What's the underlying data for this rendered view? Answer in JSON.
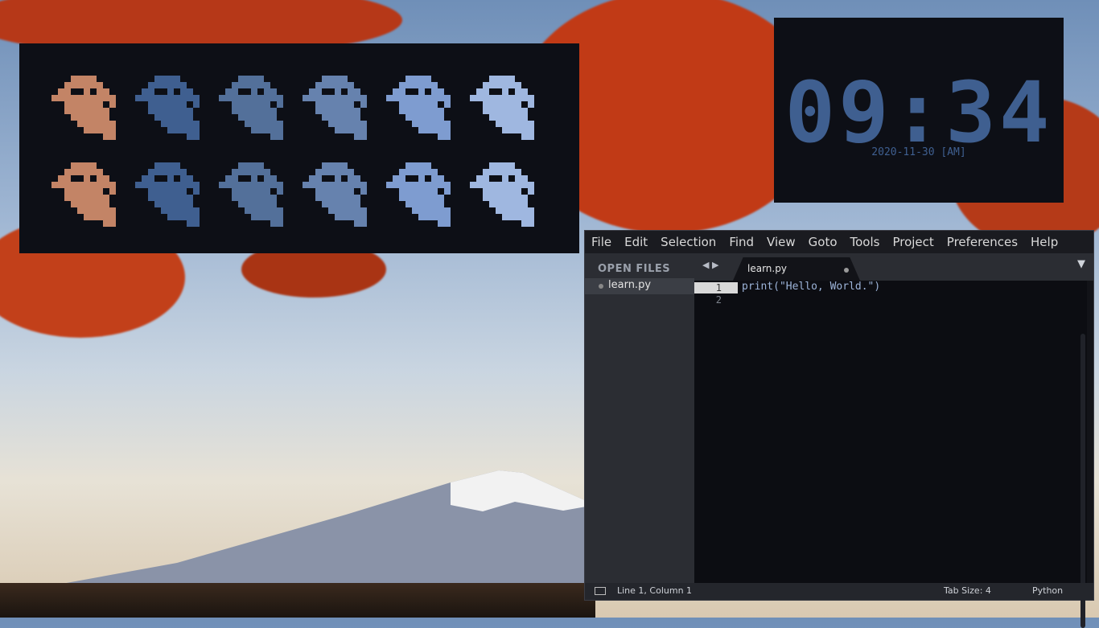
{
  "clock": {
    "time": "09:34",
    "date": "2020-11-30 [AM]",
    "color": "#3f5f90"
  },
  "ghost_panel": {
    "colors": [
      "#c38466",
      "#3f5f90",
      "#53709a",
      "#6682ae",
      "#7e9cd0",
      "#9fb7e0"
    ]
  },
  "editor": {
    "menu": [
      "File",
      "Edit",
      "Selection",
      "Find",
      "View",
      "Goto",
      "Tools",
      "Project",
      "Preferences",
      "Help"
    ],
    "sidebar": {
      "title": "OPEN FILES",
      "files": [
        "learn.py"
      ]
    },
    "tab": {
      "label": "learn.py",
      "nav": "◀ ▶",
      "dropdown": "▼"
    },
    "code": {
      "lines": [
        "1",
        "2"
      ],
      "text": "print(\"Hello, World.\")"
    },
    "status": {
      "position": "Line 1, Column 1",
      "tab_size": "Tab Size: 4",
      "syntax": "Python"
    }
  }
}
